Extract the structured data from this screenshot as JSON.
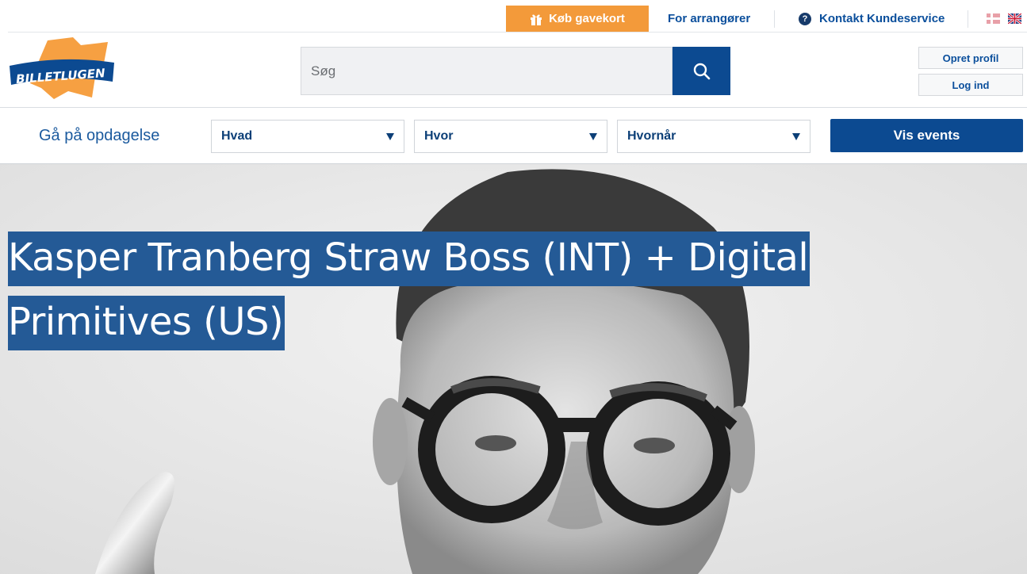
{
  "topbar": {
    "gift_label": "Køb gavekort",
    "organizers_label": "For arrangører",
    "support_label": "Kontakt Kundeservice",
    "support_icon": "question-circle-icon",
    "languages": [
      "da",
      "en"
    ]
  },
  "header": {
    "logo_text": "BILLETLUGEN",
    "search_placeholder": "Søg",
    "create_profile_label": "Opret profil",
    "login_label": "Log ind"
  },
  "discover": {
    "label": "Gå på opdagelse",
    "what_label": "Hvad",
    "where_label": "Hvor",
    "when_label": "Hvornår",
    "submit_label": "Vis events"
  },
  "hero": {
    "title": "Kasper Tranberg Straw Boss (INT) + Digital Primitives (US)"
  },
  "colors": {
    "brand_blue": "#0c4a91",
    "gift_orange": "#f39a3a",
    "title_highlight": "#245a96"
  }
}
